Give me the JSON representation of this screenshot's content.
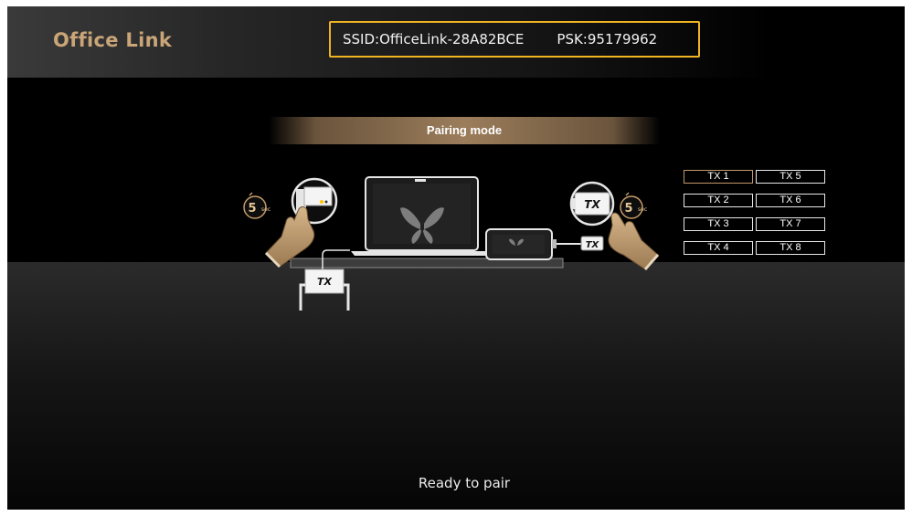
{
  "header": {
    "brand": "Office Link",
    "ssid": "SSID:OfficeLink-28A82BCE",
    "psk": "PSK:95179962"
  },
  "mode": {
    "label": "Pairing mode"
  },
  "diagram": {
    "left_timer": {
      "digit": "5",
      "unit": "sec"
    },
    "right_timer": {
      "digit": "5",
      "unit": "sec"
    },
    "dongle_right_label": "TX",
    "dongle_small_label": "TX",
    "dongle_bottom_label": "TX"
  },
  "tx_list": {
    "items": [
      "TX 1",
      "TX 2",
      "TX 3",
      "TX 4",
      "TX 5",
      "TX 6",
      "TX 7",
      "TX 8"
    ],
    "selected": "TX 1",
    "accent_color": "#c59a6a"
  },
  "status": {
    "text": "Ready to pair"
  },
  "colors": {
    "brand": "#c9a577",
    "wifi_border": "#f0b423"
  }
}
